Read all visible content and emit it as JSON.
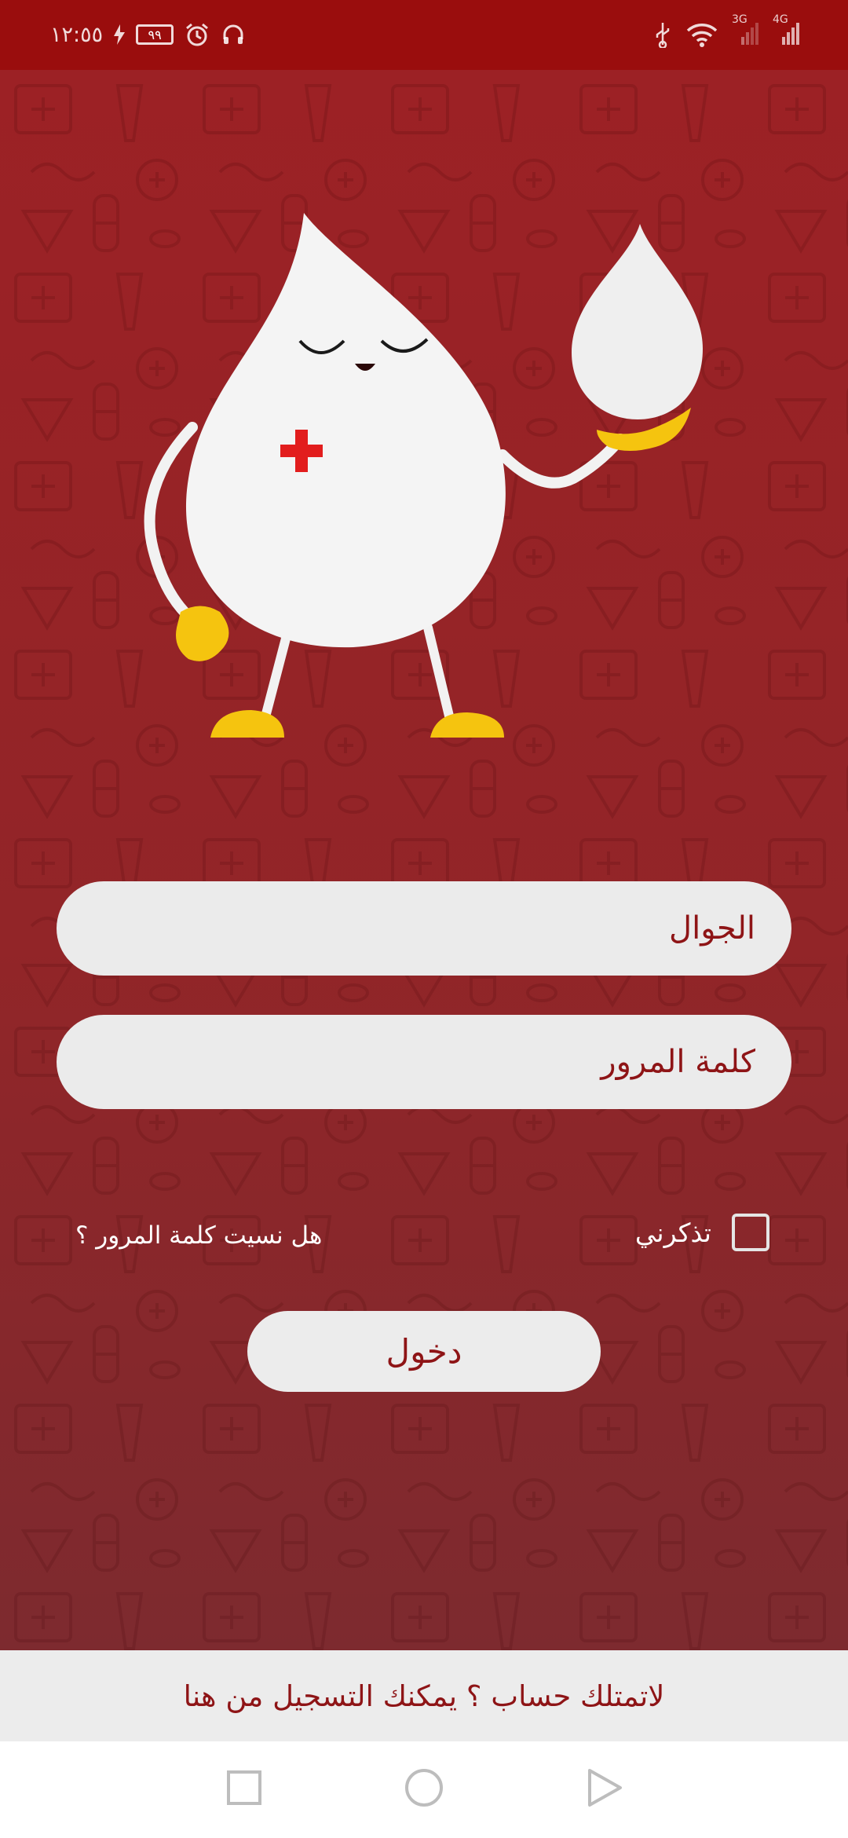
{
  "status_bar": {
    "time": "١٢:٥٥",
    "battery": "٩٩",
    "net_3g": "3G",
    "net_4g": "4G"
  },
  "colors": {
    "brand_red": "#9a0d0d",
    "background_red": "#922528",
    "field_bg": "#ebebeb",
    "mascot_yellow": "#f5c40f",
    "cross_red": "#e21d1d"
  },
  "form": {
    "phone_placeholder": "الجوال",
    "password_placeholder": "كلمة المرور",
    "remember_label": "تذكرني",
    "forgot_password": "هل نسيت كلمة المرور ؟",
    "login_button": "دخول"
  },
  "footer": {
    "register_text": "لاتمتلك حساب ؟ يمكنك التسجيل من هنا"
  },
  "nav": {
    "recents": "square-icon",
    "home": "circle-icon",
    "back": "triangle-back-icon"
  }
}
